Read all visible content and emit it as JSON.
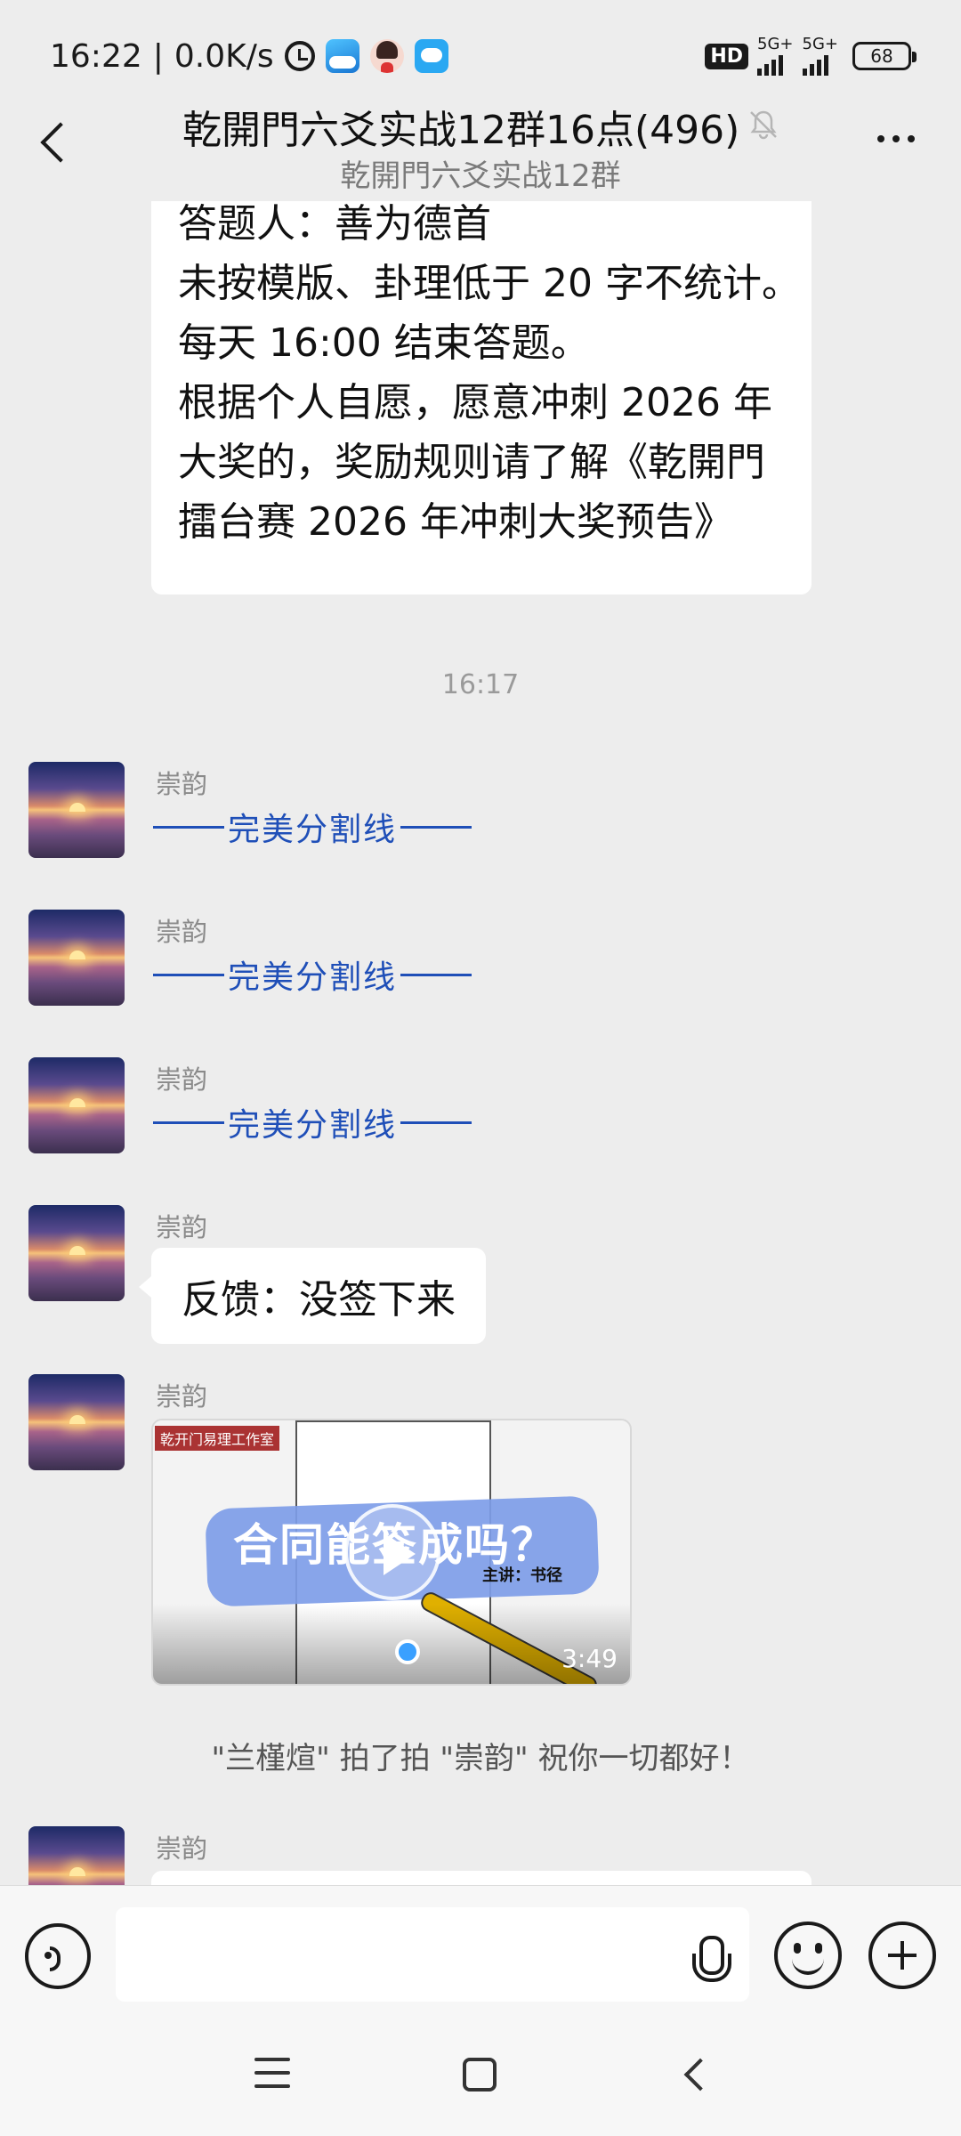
{
  "status_bar": {
    "time": "16:22",
    "separator": "|",
    "network_speed": "0.0K/s",
    "icons": [
      "alarm-icon",
      "weather-app-icon",
      "avatar-app-icon",
      "cloud-app-icon"
    ],
    "hd_badge": "HD",
    "sim1_label": "5G+",
    "sim2_label": "5G+",
    "battery": "68"
  },
  "header": {
    "title": "乾開門六爻实战12群16点(496)",
    "subtitle": "乾開門六爻实战12群",
    "muted": true
  },
  "messages": {
    "top_bubble_lines": [
      "答题人：善为德首",
      "未按模版、卦理低于 20 字不统计。",
      "每天 16:00 结束答题。",
      "根据个人自愿，愿意冲刺 2026 年",
      "大奖的，奖励规则请了解《乾開門",
      "擂台赛 2026 年冲刺大奖预告》"
    ],
    "time_separator": "16:17",
    "sender_name": "崇韵",
    "divider_text": "完美分割线",
    "feedback_text": "反馈：没签下来",
    "video": {
      "tag": "乾开门易理工作室",
      "title": "合同能签成吗？",
      "host": "主讲：书径",
      "duration": "3:49"
    },
    "system_notice": "\"兰槿煊\" 拍了拍 \"崇韵\" 祝你一切都好！"
  },
  "input_bar": {
    "placeholder": ""
  },
  "colors": {
    "background": "#ededed",
    "bubble": "#ffffff",
    "divider_blue": "#1f4fb8",
    "video_banner": "#7e9de8"
  }
}
